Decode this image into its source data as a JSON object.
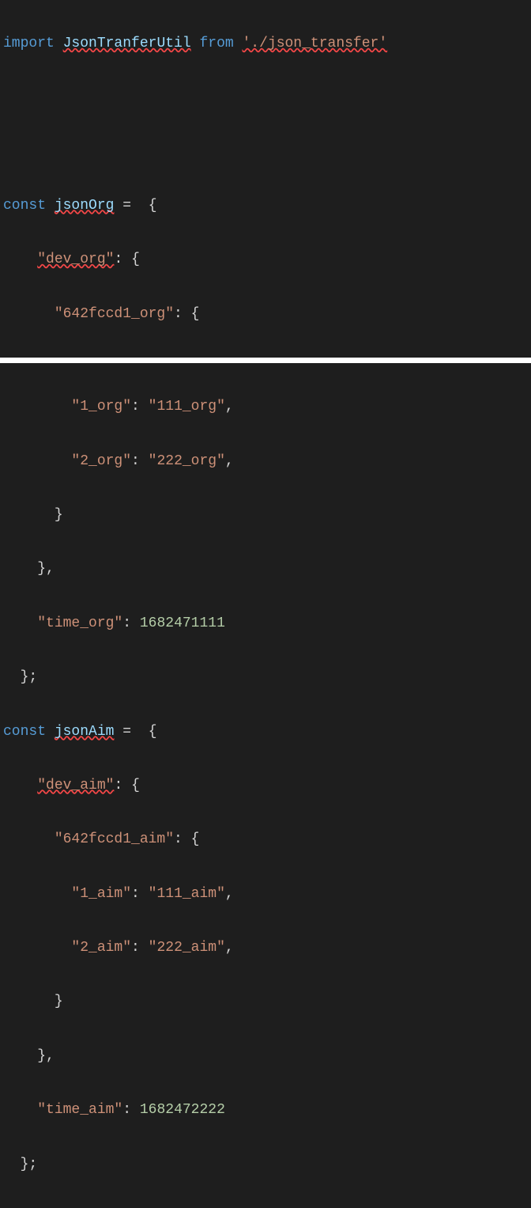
{
  "code": {
    "import_kw": "import",
    "import_ident": "JsonTranferUtil",
    "from_kw": "from",
    "import_path": "'./json_transfer'",
    "const_kw": "const",
    "jsonOrg_name": "jsonOrg",
    "eq": "=",
    "brace_open": "{",
    "brace_close": "}",
    "bracket_close_semi": "};",
    "comma": ",",
    "colon": ":",
    "dev_org_key": "\"dev_org\"",
    "hash_org_key": "\"642fccd1_org\"",
    "one_org_key": "\"1_org\"",
    "one_org_val": "\"111_org\"",
    "two_org_key": "\"2_org\"",
    "two_org_val": "\"222_org\"",
    "time_org_key": "\"time_org\"",
    "time_org_val": "1682471111",
    "jsonAim_name": "jsonAim",
    "dev_aim_key": "\"dev_aim\"",
    "hash_aim_key": "\"642fccd1_aim\"",
    "one_aim_key": "\"1_aim\"",
    "one_aim_val": "\"111_aim\"",
    "two_aim_key": "\"2_aim\"",
    "two_aim_val": "\"222_aim\"",
    "time_aim_key": "\"time_aim\"",
    "time_aim_val": "1682472222"
  }
}
